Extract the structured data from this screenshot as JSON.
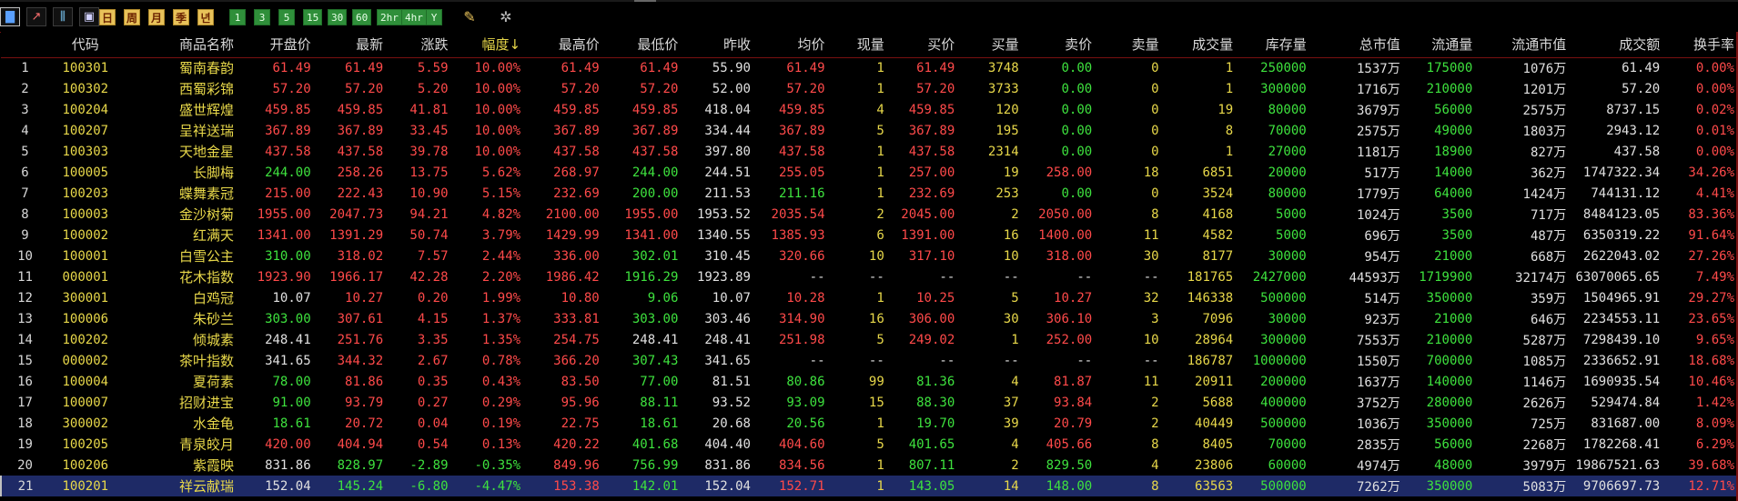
{
  "toolbar": {
    "tools": [
      {
        "name": "bar-chart-icon",
        "glyph": "▇"
      },
      {
        "name": "line-chart-icon",
        "glyph": "↗"
      },
      {
        "name": "candle-chart-icon",
        "glyph": "⫼"
      },
      {
        "name": "image-icon",
        "glyph": "▣"
      }
    ],
    "periods": [
      "日",
      "周",
      "月",
      "季",
      "년"
    ],
    "intervals": [
      "1",
      "3",
      "5",
      "15",
      "30",
      "60",
      "2hr",
      "4hr",
      "Y"
    ],
    "extra": [
      {
        "name": "notepad-icon",
        "glyph": "✎"
      },
      {
        "name": "gear-icon",
        "glyph": "✲"
      }
    ]
  },
  "colors": {
    "up": "#ff4a4a",
    "down": "#3ee23e",
    "flat": "#e0e0e0",
    "name": "#e8d84a",
    "selected_row": "#1e2a66"
  },
  "columns": [
    {
      "key": "idx",
      "label": ""
    },
    {
      "key": "code",
      "label": "代码"
    },
    {
      "key": "name",
      "label": "商品名称"
    },
    {
      "key": "open",
      "label": "开盘价"
    },
    {
      "key": "last",
      "label": "最新"
    },
    {
      "key": "chg",
      "label": "涨跌"
    },
    {
      "key": "pct",
      "label": "幅度↓"
    },
    {
      "key": "high",
      "label": "最高价"
    },
    {
      "key": "low",
      "label": "最低价"
    },
    {
      "key": "prev",
      "label": "昨收"
    },
    {
      "key": "avg",
      "label": "均价"
    },
    {
      "key": "vol_now",
      "label": "现量"
    },
    {
      "key": "bid",
      "label": "买价"
    },
    {
      "key": "bid_vol",
      "label": "买量"
    },
    {
      "key": "ask",
      "label": "卖价"
    },
    {
      "key": "ask_vol",
      "label": "卖量"
    },
    {
      "key": "volume",
      "label": "成交量"
    },
    {
      "key": "stock",
      "label": "库存量"
    },
    {
      "key": "mcap",
      "label": "总市值"
    },
    {
      "key": "float",
      "label": "流通量"
    },
    {
      "key": "float_mcap",
      "label": "流通市值"
    },
    {
      "key": "turnover",
      "label": "成交额"
    },
    {
      "key": "tr",
      "label": "换手率"
    }
  ],
  "rows": [
    [
      "1",
      "100301",
      "蜀南春韵",
      "61.49",
      "61.49",
      "5.59",
      "10.00%",
      "61.49",
      "61.49",
      "55.90",
      "61.49",
      "1",
      "61.49",
      "3748",
      "0.00",
      "0",
      "1",
      "250000",
      "1537万",
      "175000",
      "1076万",
      "61.49",
      "0.00%"
    ],
    [
      "2",
      "100302",
      "西蜀彩锦",
      "57.20",
      "57.20",
      "5.20",
      "10.00%",
      "57.20",
      "57.20",
      "52.00",
      "57.20",
      "1",
      "57.20",
      "3733",
      "0.00",
      "0",
      "1",
      "300000",
      "1716万",
      "210000",
      "1201万",
      "57.20",
      "0.00%"
    ],
    [
      "3",
      "100204",
      "盛世辉煌",
      "459.85",
      "459.85",
      "41.81",
      "10.00%",
      "459.85",
      "459.85",
      "418.04",
      "459.85",
      "4",
      "459.85",
      "120",
      "0.00",
      "0",
      "19",
      "80000",
      "3679万",
      "56000",
      "2575万",
      "8737.15",
      "0.02%"
    ],
    [
      "4",
      "100207",
      "呈祥送瑞",
      "367.89",
      "367.89",
      "33.45",
      "10.00%",
      "367.89",
      "367.89",
      "334.44",
      "367.89",
      "5",
      "367.89",
      "195",
      "0.00",
      "0",
      "8",
      "70000",
      "2575万",
      "49000",
      "1803万",
      "2943.12",
      "0.01%"
    ],
    [
      "5",
      "100303",
      "天地金星",
      "437.58",
      "437.58",
      "39.78",
      "10.00%",
      "437.58",
      "437.58",
      "397.80",
      "437.58",
      "1",
      "437.58",
      "2314",
      "0.00",
      "0",
      "1",
      "27000",
      "1181万",
      "18900",
      "827万",
      "437.58",
      "0.00%"
    ],
    [
      "6",
      "100005",
      "长脚梅",
      "244.00",
      "258.26",
      "13.75",
      "5.62%",
      "268.97",
      "244.00",
      "244.51",
      "255.05",
      "1",
      "257.00",
      "19",
      "258.00",
      "18",
      "6851",
      "20000",
      "517万",
      "14000",
      "362万",
      "1747322.34",
      "34.26%"
    ],
    [
      "7",
      "100203",
      "蝶舞素冠",
      "215.00",
      "222.43",
      "10.90",
      "5.15%",
      "232.69",
      "200.00",
      "211.53",
      "211.16",
      "1",
      "232.69",
      "253",
      "0.00",
      "0",
      "3524",
      "80000",
      "1779万",
      "64000",
      "1424万",
      "744131.12",
      "4.41%"
    ],
    [
      "8",
      "100003",
      "金沙树菊",
      "1955.00",
      "2047.73",
      "94.21",
      "4.82%",
      "2100.00",
      "1955.00",
      "1953.52",
      "2035.54",
      "2",
      "2045.00",
      "2",
      "2050.00",
      "8",
      "4168",
      "5000",
      "1024万",
      "3500",
      "717万",
      "8484123.05",
      "83.36%"
    ],
    [
      "9",
      "100002",
      "红满天",
      "1341.00",
      "1391.29",
      "50.74",
      "3.79%",
      "1429.99",
      "1341.00",
      "1340.55",
      "1385.93",
      "6",
      "1391.00",
      "16",
      "1400.00",
      "11",
      "4582",
      "5000",
      "696万",
      "3500",
      "487万",
      "6350319.22",
      "91.64%"
    ],
    [
      "10",
      "100001",
      "白雪公主",
      "310.00",
      "318.02",
      "7.57",
      "2.44%",
      "336.00",
      "302.01",
      "310.45",
      "320.66",
      "10",
      "317.10",
      "10",
      "318.00",
      "30",
      "8177",
      "30000",
      "954万",
      "21000",
      "668万",
      "2622043.02",
      "27.26%"
    ],
    [
      "11",
      "000001",
      "花木指数",
      "1923.90",
      "1966.17",
      "42.28",
      "2.20%",
      "1986.42",
      "1916.29",
      "1923.89",
      "--",
      "--",
      "--",
      "--",
      "--",
      "--",
      "181765",
      "2427000",
      "44593万",
      "1719900",
      "32174万",
      "63070065.65",
      "7.49%"
    ],
    [
      "12",
      "300001",
      "白鸡冠",
      "10.07",
      "10.27",
      "0.20",
      "1.99%",
      "10.80",
      "9.06",
      "10.07",
      "10.28",
      "1",
      "10.25",
      "5",
      "10.27",
      "32",
      "146338",
      "500000",
      "514万",
      "350000",
      "359万",
      "1504965.91",
      "29.27%"
    ],
    [
      "13",
      "100006",
      "朱砂兰",
      "303.00",
      "307.61",
      "4.15",
      "1.37%",
      "333.81",
      "303.00",
      "303.46",
      "314.90",
      "16",
      "306.00",
      "30",
      "306.10",
      "3",
      "7096",
      "30000",
      "923万",
      "21000",
      "646万",
      "2234553.11",
      "23.65%"
    ],
    [
      "14",
      "100202",
      "倾城素",
      "248.41",
      "251.76",
      "3.35",
      "1.35%",
      "254.75",
      "248.41",
      "248.41",
      "251.98",
      "5",
      "249.02",
      "1",
      "252.00",
      "10",
      "28964",
      "300000",
      "7553万",
      "210000",
      "5287万",
      "7298439.10",
      "9.65%"
    ],
    [
      "15",
      "000002",
      "茶叶指数",
      "341.65",
      "344.32",
      "2.67",
      "0.78%",
      "366.20",
      "307.43",
      "341.65",
      "--",
      "--",
      "--",
      "--",
      "--",
      "--",
      "186787",
      "1000000",
      "1550万",
      "700000",
      "1085万",
      "2336652.91",
      "18.68%"
    ],
    [
      "16",
      "100004",
      "夏荷素",
      "78.00",
      "81.86",
      "0.35",
      "0.43%",
      "83.50",
      "77.00",
      "81.51",
      "80.86",
      "99",
      "81.36",
      "4",
      "81.87",
      "11",
      "20911",
      "200000",
      "1637万",
      "140000",
      "1146万",
      "1690935.54",
      "10.46%"
    ],
    [
      "17",
      "100007",
      "招财进宝",
      "91.00",
      "93.79",
      "0.27",
      "0.29%",
      "95.96",
      "88.11",
      "93.52",
      "93.09",
      "15",
      "88.30",
      "37",
      "93.84",
      "2",
      "5688",
      "400000",
      "3752万",
      "280000",
      "2626万",
      "529474.84",
      "1.42%"
    ],
    [
      "18",
      "300002",
      "水金龟",
      "18.61",
      "20.72",
      "0.04",
      "0.19%",
      "22.75",
      "18.61",
      "20.68",
      "20.56",
      "1",
      "19.70",
      "39",
      "20.79",
      "2",
      "40449",
      "500000",
      "1036万",
      "350000",
      "725万",
      "831687.00",
      "8.09%"
    ],
    [
      "19",
      "100205",
      "青泉皎月",
      "420.00",
      "404.94",
      "0.54",
      "0.13%",
      "420.22",
      "401.68",
      "404.40",
      "404.60",
      "5",
      "401.65",
      "4",
      "405.66",
      "8",
      "8405",
      "70000",
      "2835万",
      "56000",
      "2268万",
      "1782268.41",
      "6.29%"
    ],
    [
      "20",
      "100206",
      "紫霞映",
      "831.86",
      "828.97",
      "-2.89",
      "-0.35%",
      "849.96",
      "756.99",
      "831.86",
      "834.56",
      "1",
      "807.11",
      "2",
      "829.50",
      "4",
      "23806",
      "60000",
      "4974万",
      "48000",
      "3979万",
      "19867521.63",
      "39.68%"
    ],
    [
      "21",
      "100201",
      "祥云献瑞",
      "152.04",
      "145.24",
      "-6.80",
      "-4.47%",
      "153.38",
      "142.01",
      "152.04",
      "152.71",
      "1",
      "143.05",
      "14",
      "148.00",
      "8",
      "63563",
      "500000",
      "7262万",
      "350000",
      "5083万",
      "9706697.73",
      "12.71%"
    ]
  ],
  "selected_row": 20
}
